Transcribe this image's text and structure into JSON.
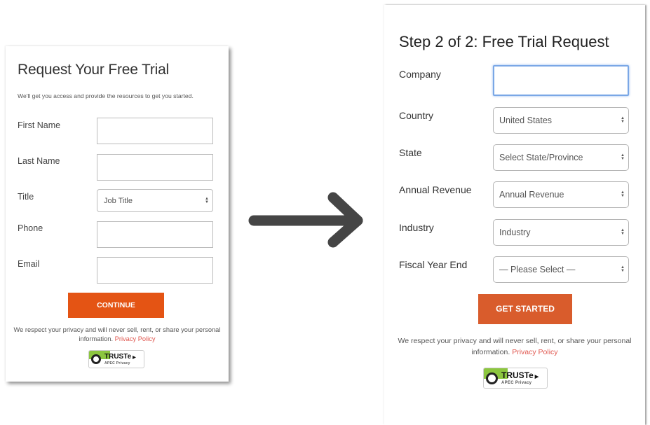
{
  "step1": {
    "title": "Request Your Free Trial",
    "intro": "We'll get you access and provide the resources to get you started.",
    "fields": [
      {
        "label": "First Name",
        "type": "text",
        "value": ""
      },
      {
        "label": "Last Name",
        "type": "text",
        "value": ""
      },
      {
        "label": "Title",
        "type": "select",
        "value": "Job Title"
      },
      {
        "label": "Phone",
        "type": "text",
        "value": ""
      },
      {
        "label": "Email",
        "type": "text",
        "value": ""
      }
    ],
    "submit_label": "CONTINUE",
    "privacy_text": "We respect your privacy and will never sell, rent, or share your personal information.",
    "privacy_link": "Privacy Policy",
    "badge": {
      "name": "TRUSTe",
      "subtitle": "APEC Privacy"
    }
  },
  "arrow": {
    "icon": "arrow-right-icon"
  },
  "step2": {
    "title": "Step 2 of 2: Free Trial Request",
    "fields": [
      {
        "label": "Company",
        "type": "text",
        "value": "",
        "focused": true
      },
      {
        "label": "Country",
        "type": "select",
        "value": "United States"
      },
      {
        "label": "State",
        "type": "select",
        "value": "Select State/Province"
      },
      {
        "label": "Annual Revenue",
        "type": "select",
        "value": "Annual Revenue"
      },
      {
        "label": "Industry",
        "type": "select",
        "value": "Industry"
      },
      {
        "label": "Fiscal Year End",
        "type": "select",
        "value": "— Please Select —"
      }
    ],
    "submit_label": "GET STARTED",
    "privacy_text": "We respect your privacy and will never sell, rent, or share your personal information.",
    "privacy_link": "Privacy Policy",
    "badge": {
      "name": "TRUSTe",
      "subtitle": "APEC Privacy"
    }
  },
  "colors": {
    "continue_button": "#e45414",
    "get_started_button": "#d95c2c",
    "link": "#e0574f",
    "focus_ring": "#7aa7e6",
    "badge_green": "#8cc63f"
  }
}
